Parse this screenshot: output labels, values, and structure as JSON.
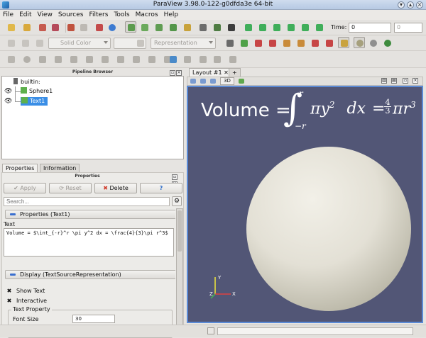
{
  "window": {
    "title": "ParaView 3.98.0-122-g0dfda3e 64-bit"
  },
  "menus": [
    "File",
    "Edit",
    "View",
    "Sources",
    "Filters",
    "Tools",
    "Macros",
    "Help"
  ],
  "toolbar": {
    "time_label": "Time:",
    "time_value": "0",
    "time_index": "0",
    "color_by": "Solid Color",
    "representation": "Representation"
  },
  "pipeline": {
    "header": "Pipeline Browser",
    "items": [
      {
        "label": "builtin:",
        "icon": "server-icon"
      },
      {
        "label": "Sphere1",
        "icon": "sphere-source-icon",
        "visible": true
      },
      {
        "label": "Text1",
        "icon": "text-source-icon",
        "visible": true,
        "selected": true
      }
    ]
  },
  "tabs": {
    "properties": "Properties",
    "information": "Information"
  },
  "properties": {
    "header": "Properties",
    "apply": "Apply",
    "reset": "Reset",
    "delete": "Delete",
    "help": "?",
    "search_placeholder": "Search...",
    "section_props": "Properties (Text1)",
    "text_label": "Text",
    "text_value": "Volume = $\\int_{-r}^r \\pi y^2 dx = \\frac{4}{3}\\pi r^3$",
    "section_display": "Display (TextSourceRepresentation)",
    "show_text": "Show Text",
    "interactive": "Interactive",
    "text_property": "Text Property",
    "font_size": "Font Size",
    "font_size_value": "30"
  },
  "layout": {
    "tab": "Layout #1",
    "add": "+",
    "view3d": "3D"
  },
  "render": {
    "equation_lead": "Volume =",
    "upper_limit": "r",
    "lower_limit": "−r",
    "integrand": "πy",
    "power": "2",
    "dx": "dx",
    "eq": "=",
    "frac_num": "4",
    "frac_den": "3",
    "rhs": "πr",
    "rhs_power": "3",
    "axis_x": "X",
    "axis_y": "Y",
    "axis_z": "Z",
    "background": "#525676",
    "sphere_color": "#e3e0d5",
    "text_color": "#ffffff"
  }
}
